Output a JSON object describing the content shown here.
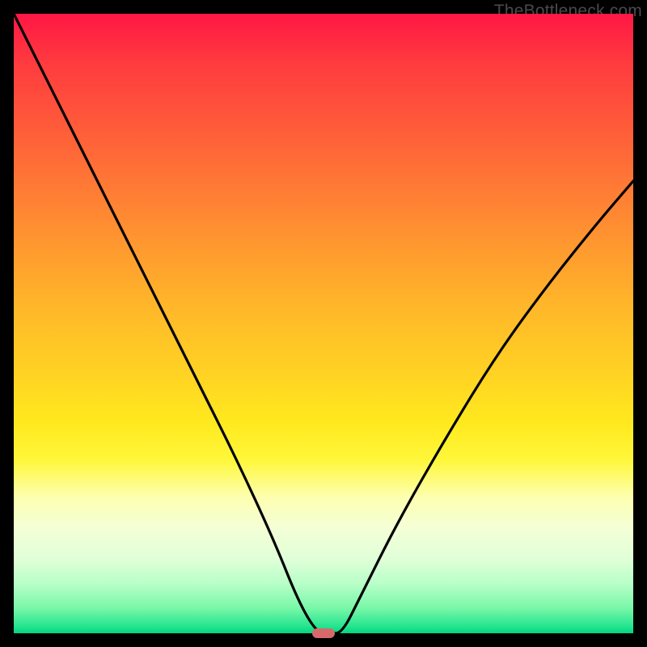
{
  "watermark": {
    "text": "TheBottleneck.com"
  },
  "colors": {
    "background": "#000000",
    "curve": "#000000",
    "marker": "#d66a6a",
    "gradient_top": "#ff1744",
    "gradient_bottom": "#00d77f"
  },
  "chart_data": {
    "type": "line",
    "title": "",
    "xlabel": "",
    "ylabel": "",
    "xlim": [
      0,
      100
    ],
    "ylim": [
      0,
      100
    ],
    "grid": false,
    "legend": false,
    "series": [
      {
        "name": "bottleneck-curve",
        "x": [
          0,
          6,
          12,
          18,
          24,
          30,
          36,
          42,
          46,
          49,
          51,
          53,
          56,
          62,
          70,
          78,
          86,
          94,
          100
        ],
        "values": [
          100,
          88,
          76,
          64,
          52,
          40,
          28,
          15,
          5,
          0,
          0,
          0,
          6,
          18,
          32,
          45,
          56,
          66,
          73
        ]
      }
    ],
    "marker": {
      "x": 50,
      "y": 0
    },
    "background_gradient": {
      "orientation": "vertical",
      "stops": [
        {
          "pos": 0,
          "color": "#ff1744"
        },
        {
          "pos": 50,
          "color": "#ffb929"
        },
        {
          "pos": 72,
          "color": "#fff73a"
        },
        {
          "pos": 88,
          "color": "#e0ffd8"
        },
        {
          "pos": 100,
          "color": "#00d77f"
        }
      ]
    }
  }
}
